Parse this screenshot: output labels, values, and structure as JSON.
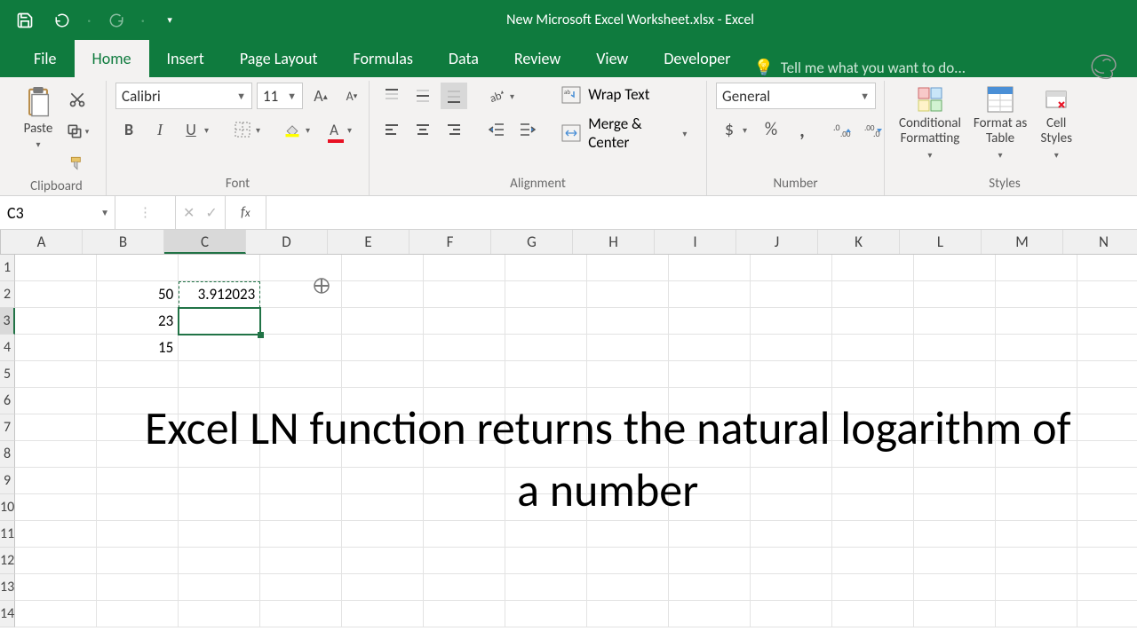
{
  "title": "New Microsoft Excel Worksheet.xlsx - Excel",
  "tabs": {
    "file": "File",
    "home": "Home",
    "insert": "Insert",
    "page_layout": "Page Layout",
    "formulas": "Formulas",
    "data": "Data",
    "review": "Review",
    "view": "View",
    "developer": "Developer"
  },
  "tell_me": "Tell me what you want to do...",
  "ribbon": {
    "clipboard": {
      "label": "Clipboard",
      "paste": "Paste"
    },
    "font": {
      "label": "Font",
      "name": "Calibri",
      "size": "11",
      "bold": "B",
      "italic": "I",
      "underline": "U"
    },
    "alignment": {
      "label": "Alignment",
      "wrap": "Wrap Text",
      "merge": "Merge & Center"
    },
    "number": {
      "label": "Number",
      "format": "General",
      "currency": "$",
      "percent": "%",
      "comma": ","
    },
    "styles": {
      "label": "Styles",
      "cond": "Conditional\nFormatting",
      "table": "Format as\nTable",
      "cell": "Cell\nStyles"
    }
  },
  "namebox": "C3",
  "formula": "",
  "columns": [
    "A",
    "B",
    "C",
    "D",
    "E",
    "F",
    "G",
    "H",
    "I",
    "J",
    "K",
    "L",
    "M",
    "N"
  ],
  "rows": [
    "1",
    "2",
    "3",
    "4",
    "5",
    "6",
    "7",
    "8",
    "9",
    "10",
    "11",
    "12",
    "13",
    "14"
  ],
  "data": {
    "B2": "50",
    "B3": "23",
    "B4": "15",
    "C2": "3.912023"
  },
  "selected_col": "C",
  "selected_row": "3",
  "overlay": "Excel LN function returns the natural logarithm of a number"
}
